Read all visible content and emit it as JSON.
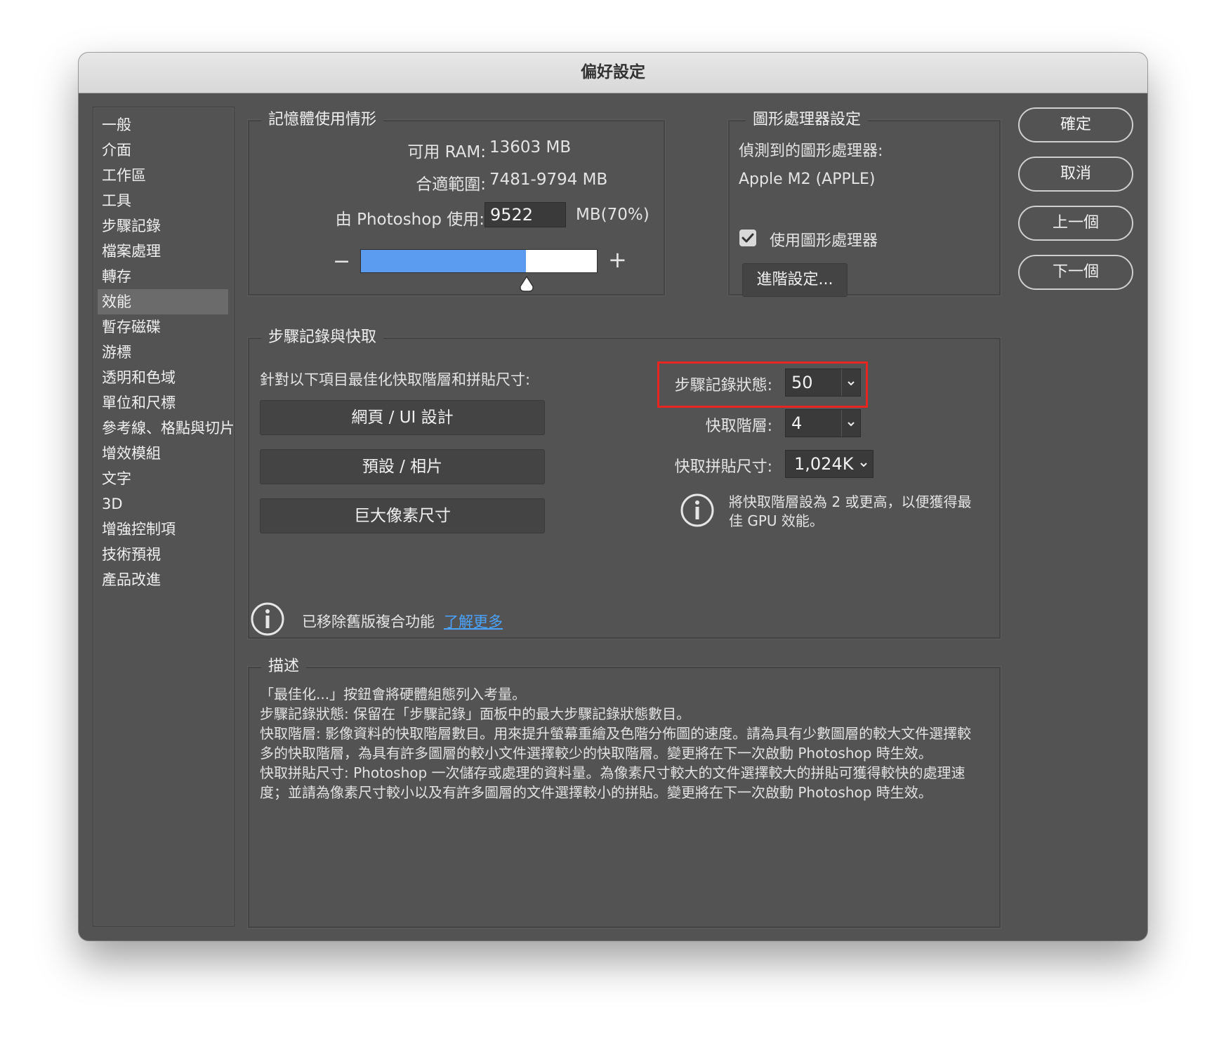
{
  "window": {
    "title": "偏好設定"
  },
  "sidebar": {
    "items": [
      {
        "label": "一般"
      },
      {
        "label": "介面"
      },
      {
        "label": "工作區"
      },
      {
        "label": "工具"
      },
      {
        "label": "步驟記錄"
      },
      {
        "label": "檔案處理"
      },
      {
        "label": "轉存"
      },
      {
        "label": "效能"
      },
      {
        "label": "暫存磁碟"
      },
      {
        "label": "游標"
      },
      {
        "label": "透明和色域"
      },
      {
        "label": "單位和尺標"
      },
      {
        "label": "參考線、格點與切片"
      },
      {
        "label": "增效模組"
      },
      {
        "label": "文字"
      },
      {
        "label": "3D"
      },
      {
        "label": "增強控制項"
      },
      {
        "label": "技術預視"
      },
      {
        "label": "產品改進"
      }
    ],
    "active": "效能"
  },
  "memory": {
    "legend": "記憶體使用情形",
    "available_label": "可用 RAM:",
    "available_value": "13603 MB",
    "range_label": "合適範圍:",
    "range_value": "7481-9794 MB",
    "used_label": "由 Photoshop 使用:",
    "used_value": "9522",
    "used_unit": "MB(70%)",
    "minus": "−",
    "plus": "+",
    "slider_fraction": 0.7
  },
  "gpu": {
    "legend": "圖形處理器設定",
    "detected_label": "偵測到的圖形處理器:",
    "detected_value": "Apple M2 (APPLE)",
    "use_gpu_label": "使用圖形處理器",
    "use_gpu_checked": true,
    "advanced_button": "進階設定..."
  },
  "buttons": {
    "ok": "確定",
    "cancel": "取消",
    "prev": "上一個",
    "next": "下一個"
  },
  "history_cache": {
    "legend": "步驟記錄與快取",
    "optimize_label": "針對以下項目最佳化快取階層和拼貼尺寸:",
    "preset_web": "網頁 / UI 設計",
    "preset_default": "預設 / 相片",
    "preset_huge": "巨大像素尺寸",
    "history_states_label": "步驟記錄狀態:",
    "history_states_value": "50",
    "cache_levels_label": "快取階層:",
    "cache_levels_value": "4",
    "tile_size_label": "快取拼貼尺寸:",
    "tile_size_value": "1,024K",
    "gpu_tip_line1": "將快取階層設為 2 或更高，以便獲得最",
    "gpu_tip_line2": "佳 GPU 效能。",
    "highlight_color": "#e8251f"
  },
  "legacy": {
    "text": "已移除舊版複合功能",
    "link": "了解更多",
    "link_color": "#4aa3ff"
  },
  "description": {
    "legend": "描述",
    "lines": [
      "「最佳化...」按鈕會將硬體組態列入考量。",
      "步驟記錄狀態: 保留在「步驟記錄」面板中的最大步驟記錄狀態數目。",
      "快取階層: 影像資料的快取階層數目。用來提升螢幕重繪及色階分佈圖的速度。請為具有少數圖層的較大文件選擇較",
      "多的快取階層，為具有許多圖層的較小文件選擇較少的快取階層。變更將在下一次啟動 Photoshop 時生效。",
      "快取拼貼尺寸: Photoshop 一次儲存或處理的資料量。為像素尺寸較大的文件選擇較大的拼貼可獲得較快的處理速",
      "度；並請為像素尺寸較小以及有許多圖層的文件選擇較小的拼貼。變更將在下一次啟動 Photoshop 時生效。"
    ]
  },
  "colors": {
    "slider_fill": "#5b9bf0",
    "panel_bg": "#535353"
  },
  "icons": {
    "info": "info-circle-icon",
    "check": "checkmark-icon",
    "chevron": "chevron-down-icon"
  }
}
